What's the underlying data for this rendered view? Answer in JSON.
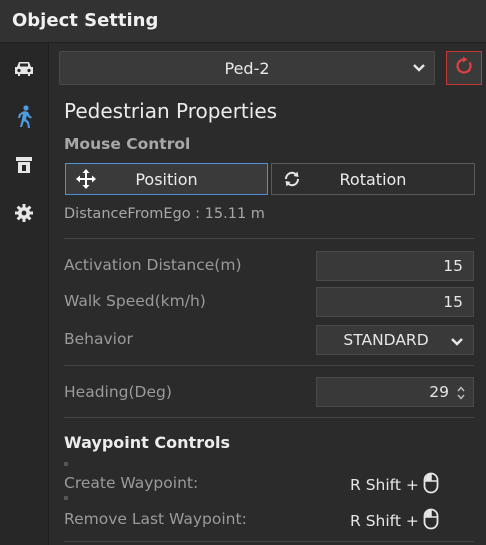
{
  "window": {
    "title": "Object Setting"
  },
  "sidebar": {
    "items": [
      {
        "icon": "car-icon"
      },
      {
        "icon": "pedestrian-icon",
        "active": true
      },
      {
        "icon": "object-icon"
      },
      {
        "icon": "gear-icon"
      }
    ],
    "active_color": "#4f9be0"
  },
  "object_selector": {
    "value": "Ped-2",
    "reset_color": "#e04040"
  },
  "section": {
    "title": "Pedestrian Properties"
  },
  "mouse_control": {
    "label": "Mouse Control",
    "position_label": "Position",
    "rotation_label": "Rotation",
    "selected": "Position"
  },
  "distance_from_ego": "DistanceFromEgo : 15.11 m",
  "properties": {
    "activation_distance": {
      "label": "Activation Distance(m)",
      "value": "15"
    },
    "walk_speed": {
      "label": "Walk Speed(km/h)",
      "value": "15"
    },
    "behavior": {
      "label": "Behavior",
      "value": "STANDARD"
    },
    "heading": {
      "label": "Heading(Deg)",
      "value": "29"
    }
  },
  "waypoints": {
    "title": "Waypoint Controls",
    "create": {
      "label": "Create Waypoint:",
      "shortcut": "R Shift +"
    },
    "remove": {
      "label": "Remove Last Waypoint:",
      "shortcut": "R Shift +"
    }
  }
}
